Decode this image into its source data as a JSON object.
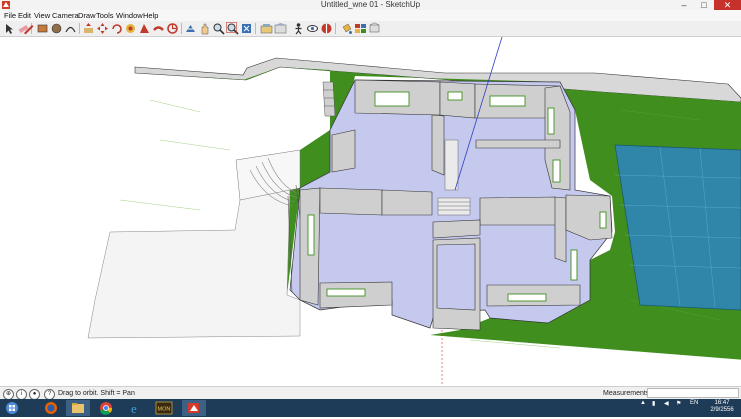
{
  "window": {
    "title": "Untitled_wne 01 - SketchUp",
    "controls": [
      "–",
      "□",
      "✕"
    ]
  },
  "menu": [
    "File",
    "Edit",
    "View",
    "Camera",
    "Draw",
    "Tools",
    "Window",
    "Help"
  ],
  "toolbar": {
    "tools": [
      "select-tool",
      "eraser-tool",
      "pencil-tool",
      "rectangle-tool",
      "circle-tool",
      "arc-tool",
      "push-pull-tool",
      "move-tool",
      "rotate-tool",
      "offset-tool",
      "scale-tool",
      "follow-me-tool",
      "tape-measure-tool",
      "dimension-tool",
      "protractor-tool",
      "text-tool",
      "axes-tool",
      "orbit-tool",
      "pan-tool",
      "zoom-tool",
      "zoom-window-tool",
      "zoom-extents-tool",
      "component-browser",
      "warehouse-tool",
      "paint-bucket-tool",
      "styles-tool",
      "walk-tool",
      "look-around-tool",
      "section-tool",
      "scenes-tool",
      "shadows-tool"
    ]
  },
  "status": {
    "hint": "Drag to orbit.  Shift = Pan",
    "measurements_label": "Measurements",
    "measurements_value": ""
  },
  "taskbar": {
    "apps": [
      "firefox",
      "explorer",
      "chrome",
      "internet-explorer",
      "mon-app",
      "sketchup"
    ],
    "clock_time": "16:47",
    "clock_date": "2/9/2556"
  },
  "colors": {
    "grass": "#3f8e1e",
    "floor": "#c5c9ee",
    "wall": "#cfcfcf",
    "pool": "#2f86a8",
    "taskbar": "#1e3b57"
  }
}
